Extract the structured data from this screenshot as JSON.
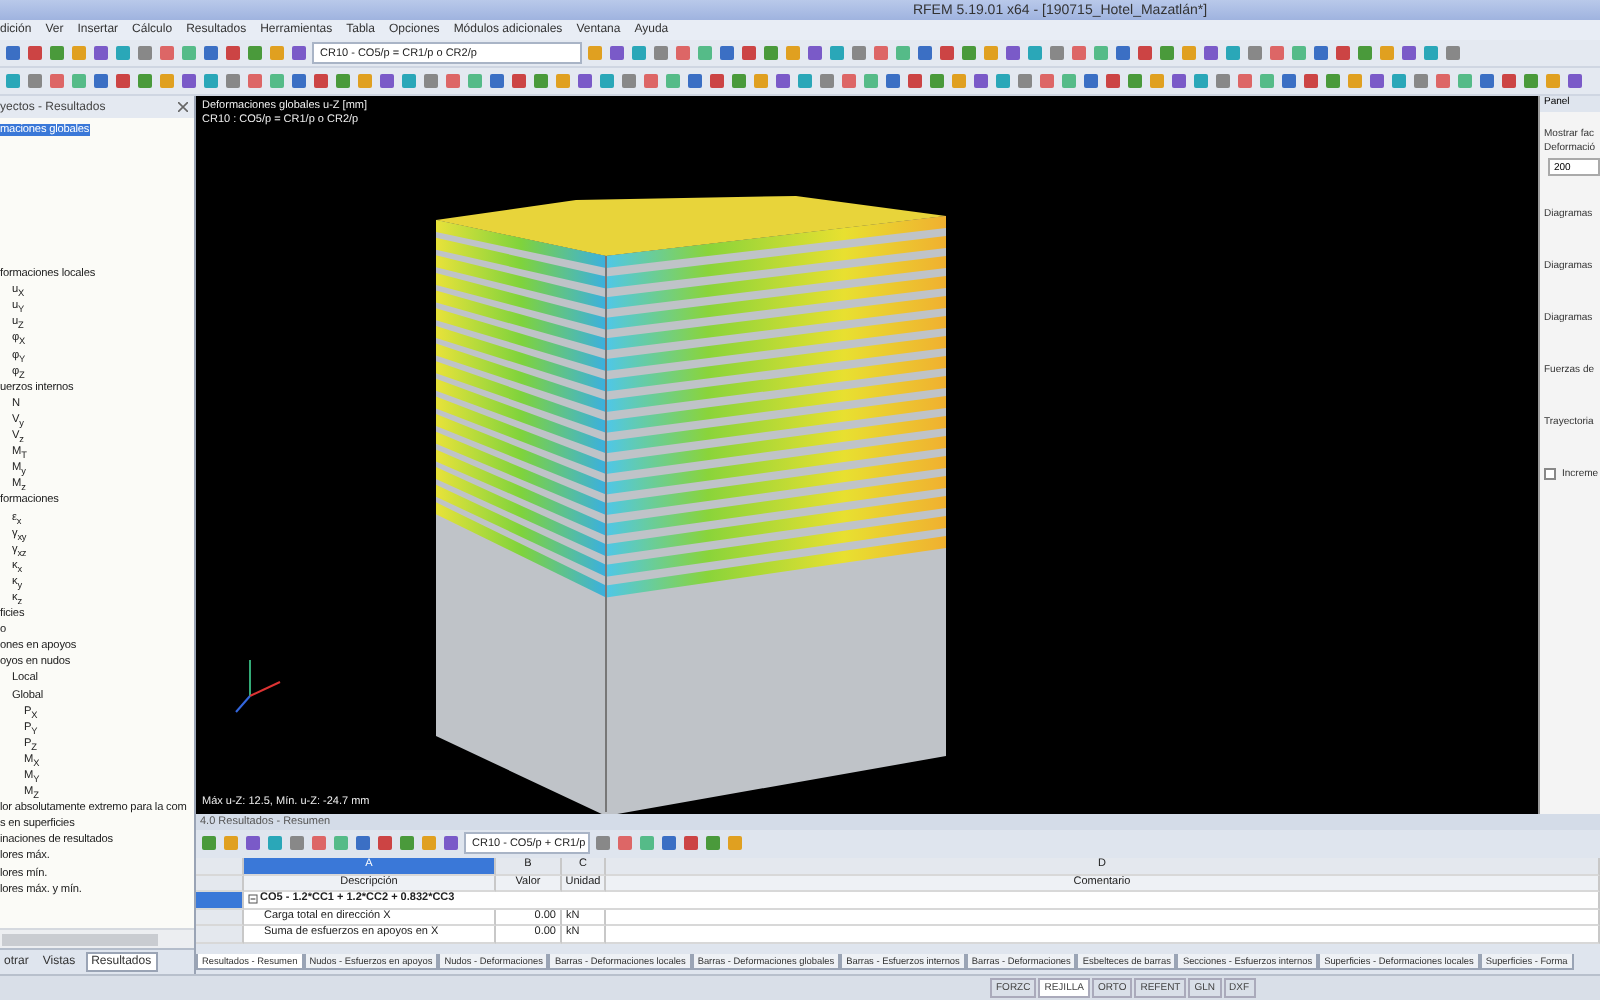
{
  "window": {
    "title": "RFEM 5.19.01 x64 - [190715_Hotel_Mazatlán*]"
  },
  "menu": [
    "dición",
    "Ver",
    "Insertar",
    "Cálculo",
    "Resultados",
    "Herramientas",
    "Tabla",
    "Opciones",
    "Módulos adicionales",
    "Ventana",
    "Ayuda"
  ],
  "toolbar": {
    "combo": "CR10 - CO5/p = CR1/p o CR2/p"
  },
  "navigator": {
    "title": "yectos - Resultados",
    "tree": [
      {
        "label": "maciones globales",
        "selected": true
      },
      {
        "label": "formaciones locales",
        "selected": false,
        "children": [
          {
            "label": "u$_{X}$",
            "selected": false
          },
          {
            "label": "u$_{Y}$",
            "selected": false
          },
          {
            "label": "u$_{Z}$",
            "selected": false
          },
          {
            "label": "φ$_{X}$",
            "selected": false
          },
          {
            "label": "φ$_{Y}$",
            "selected": false
          },
          {
            "label": "φ$_{Z}$",
            "selected": false
          }
        ]
      },
      {
        "label": "uerzos internos",
        "selected": false,
        "children": [
          {
            "label": "N",
            "selected": false
          },
          {
            "label": "V$_{y}$",
            "selected": false
          },
          {
            "label": "V$_{z}$",
            "selected": false
          },
          {
            "label": "M$_{T}$",
            "selected": false
          },
          {
            "label": "M$_{y}$",
            "selected": false
          },
          {
            "label": "M$_{z}$",
            "selected": false
          }
        ]
      },
      {
        "label": "formaciones",
        "selected": false,
        "children": [
          {
            "label": "ε$_{x}$",
            "selected": false
          },
          {
            "label": "γ$_{xy}$",
            "selected": false
          },
          {
            "label": "γ$_{xz}$",
            "selected": false
          },
          {
            "label": "κ$_{x}$",
            "selected": false
          },
          {
            "label": "κ$_{y}$",
            "selected": false
          },
          {
            "label": "κ$_{z}$",
            "selected": false
          }
        ]
      },
      {
        "label": "ficies",
        "selected": false
      },
      {
        "label": "o",
        "selected": false
      },
      {
        "label": "ones en apoyos",
        "selected": false
      },
      {
        "label": "oyos en nudos",
        "selected": false,
        "children": [
          {
            "label": "Local",
            "selected": false
          },
          {
            "label": "Global",
            "selected": false,
            "children": [
              {
                "label": "P$_{X}$",
                "selected": false
              },
              {
                "label": "P$_{Y}$",
                "selected": false
              },
              {
                "label": "P$_{Z}$",
                "selected": false
              },
              {
                "label": "M$_{X}$",
                "selected": false
              },
              {
                "label": "M$_{Y}$",
                "selected": false
              },
              {
                "label": "M$_{Z}$",
                "selected": false
              }
            ]
          }
        ]
      },
      {
        "label": "lor absolutamente extremo para la com",
        "selected": false
      },
      {
        "label": "s en superficies",
        "selected": false
      },
      {
        "label": "inaciones de resultados",
        "selected": false
      },
      {
        "label": "lores máx.",
        "selected": false
      },
      {
        "label": "lores mín.",
        "selected": false
      },
      {
        "label": "lores máx. y mín.",
        "selected": false
      }
    ],
    "tabs": [
      {
        "label": "otrar",
        "selected": false
      },
      {
        "label": "Vistas",
        "selected": false
      },
      {
        "label": "Resultados",
        "selected": true
      }
    ]
  },
  "viewport": {
    "title": "Deformaciones globales u-Z [mm]",
    "subtitle": "CR10 : CO5/p = CR1/p o CR2/p",
    "footer": "Máx u-Z: 12.5, Mín. u-Z: -24.7 mm"
  },
  "panel": {
    "title": "Panel",
    "labels": [
      "Mostrar fac",
      "Deformació"
    ],
    "value": "200",
    "sections": [
      "Diagramas",
      "Diagramas",
      "Diagramas",
      "Fuerzas de",
      "Trayectoria"
    ],
    "option": {
      "label": "Increme",
      "checked": false
    }
  },
  "results": {
    "title": "4.0 Resultados - Resumen",
    "combo": "CR10 - CO5/p + CR1/p",
    "columns": [
      {
        "letter": "A",
        "name": "Descripción"
      },
      {
        "letter": "B",
        "name": "Valor"
      },
      {
        "letter": "C",
        "name": "Unidad"
      },
      {
        "letter": "D",
        "name": "Comentario"
      }
    ],
    "group": {
      "label": "CO5 - 1.2*CC1 + 1.2*CC2 + 0.832*CC3",
      "expanded": true
    },
    "rows": [
      {
        "description": "Carga total en dirección X",
        "value": "0.00",
        "unit": "kN"
      },
      {
        "description": "Suma de esfuerzos en apoyos en X",
        "value": "0.00",
        "unit": "kN"
      }
    ],
    "tabs": [
      {
        "label": "Resultados - Resumen",
        "selected": true
      },
      {
        "label": "Nudos - Esfuerzos en apoyos",
        "selected": false
      },
      {
        "label": "Nudos - Deformaciones",
        "selected": false
      },
      {
        "label": "Barras - Deformaciones locales",
        "selected": false
      },
      {
        "label": "Barras - Deformaciones globales",
        "selected": false
      },
      {
        "label": "Barras - Esfuerzos internos",
        "selected": false
      },
      {
        "label": "Barras - Deformaciones",
        "selected": false
      },
      {
        "label": "Esbelteces de barras",
        "selected": false
      },
      {
        "label": "Secciones - Esfuerzos internos",
        "selected": false
      },
      {
        "label": "Superficies - Deformaciones locales",
        "selected": false
      },
      {
        "label": "Superficies - Forma",
        "selected": false
      }
    ]
  },
  "status_bar": [
    {
      "label": "FORZC",
      "on": false
    },
    {
      "label": "REJILLA",
      "on": true
    },
    {
      "label": "ORTO",
      "on": false
    },
    {
      "label": "REFENT",
      "on": false
    },
    {
      "label": "GLN",
      "on": false
    },
    {
      "label": "DXF",
      "on": false
    }
  ]
}
